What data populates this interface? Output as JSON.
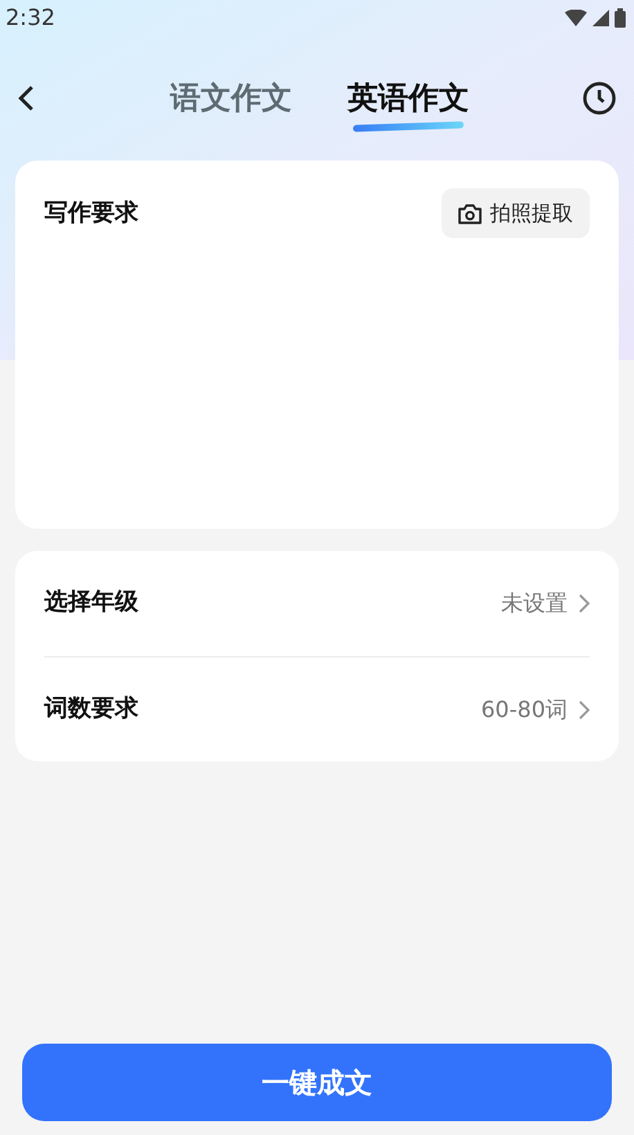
{
  "status_bar": {
    "time": "2:32"
  },
  "tabs": [
    {
      "label": "语文作文",
      "selected": false
    },
    {
      "label": "英语作文",
      "selected": true
    }
  ],
  "requirement_card": {
    "title": "写作要求",
    "photo_button": "拍照提取"
  },
  "settings": [
    {
      "label": "选择年级",
      "value": "未设置"
    },
    {
      "label": "词数要求",
      "value": "60-80词"
    }
  ],
  "submit_button": "一键成文"
}
